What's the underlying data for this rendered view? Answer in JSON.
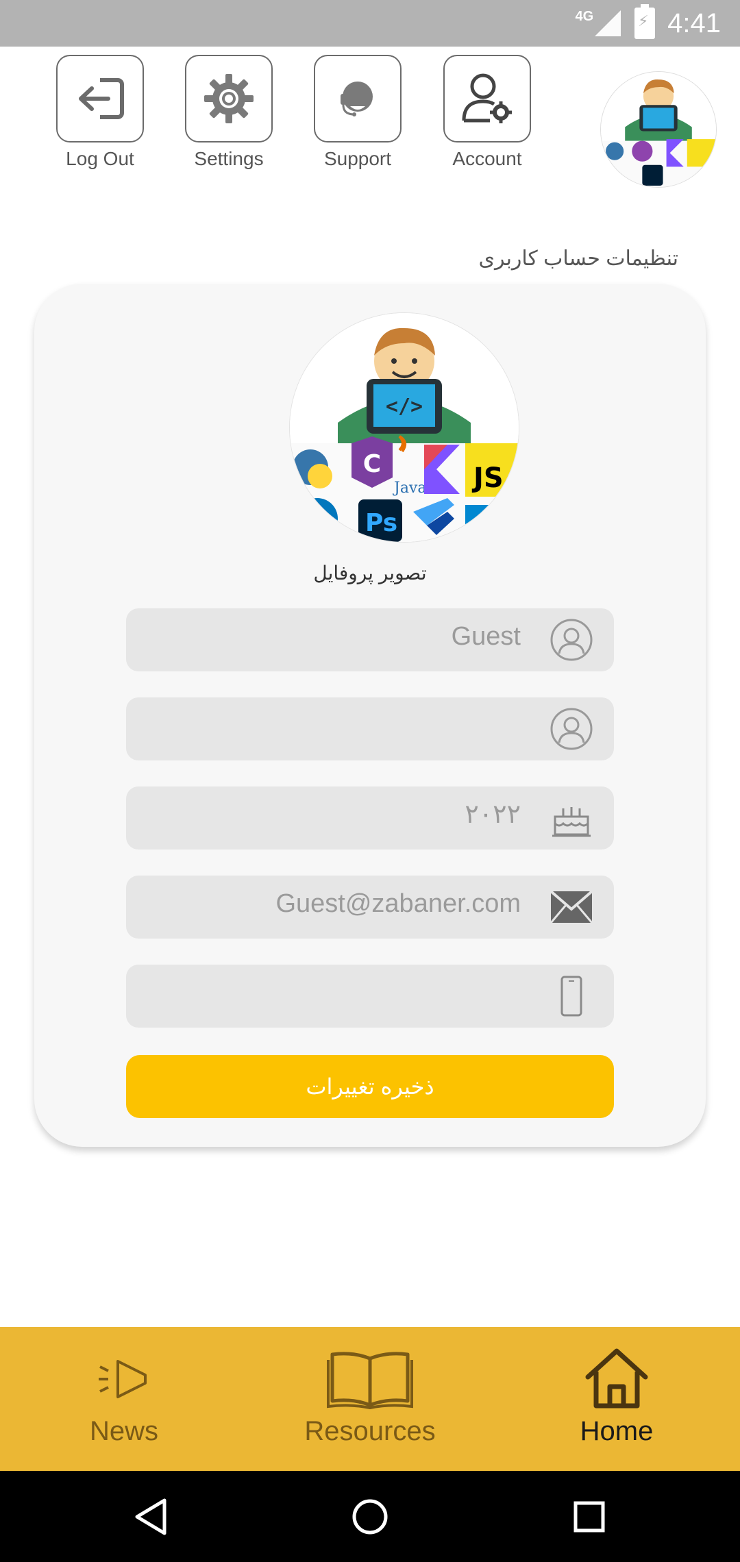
{
  "status_bar": {
    "network": "4G",
    "time": "4:41"
  },
  "top_actions": [
    {
      "label": "Log Out",
      "icon": "logout-icon"
    },
    {
      "label": "Settings",
      "icon": "gear-icon"
    },
    {
      "label": "Support",
      "icon": "headset-icon"
    },
    {
      "label": "Account",
      "icon": "user-gear-icon"
    }
  ],
  "page_title": "تنظیمات حساب کاربری",
  "profile": {
    "label": "تصویر پروفایل"
  },
  "fields": {
    "name": {
      "value": "Guest",
      "icon": "user-circle-icon"
    },
    "family": {
      "value": "",
      "icon": "user-circle-icon"
    },
    "birth_year": {
      "value": "۲۰۲۲",
      "icon": "cake-icon"
    },
    "email": {
      "value": "Guest@zabaner.com",
      "icon": "mail-icon"
    },
    "phone": {
      "value": "",
      "icon": "phone-icon"
    }
  },
  "save_button": {
    "label": "ذخیره تغییرات"
  },
  "colors": {
    "accent": "#fcc200",
    "nav_bg": "#ebb734",
    "card_bg": "#f7f7f7",
    "field_bg": "#e6e6e6"
  },
  "bottom_nav": [
    {
      "label": "News",
      "icon": "megaphone-icon",
      "active": false
    },
    {
      "label": "Resources",
      "icon": "book-icon",
      "active": false
    },
    {
      "label": "Home",
      "icon": "home-icon",
      "active": true
    }
  ]
}
